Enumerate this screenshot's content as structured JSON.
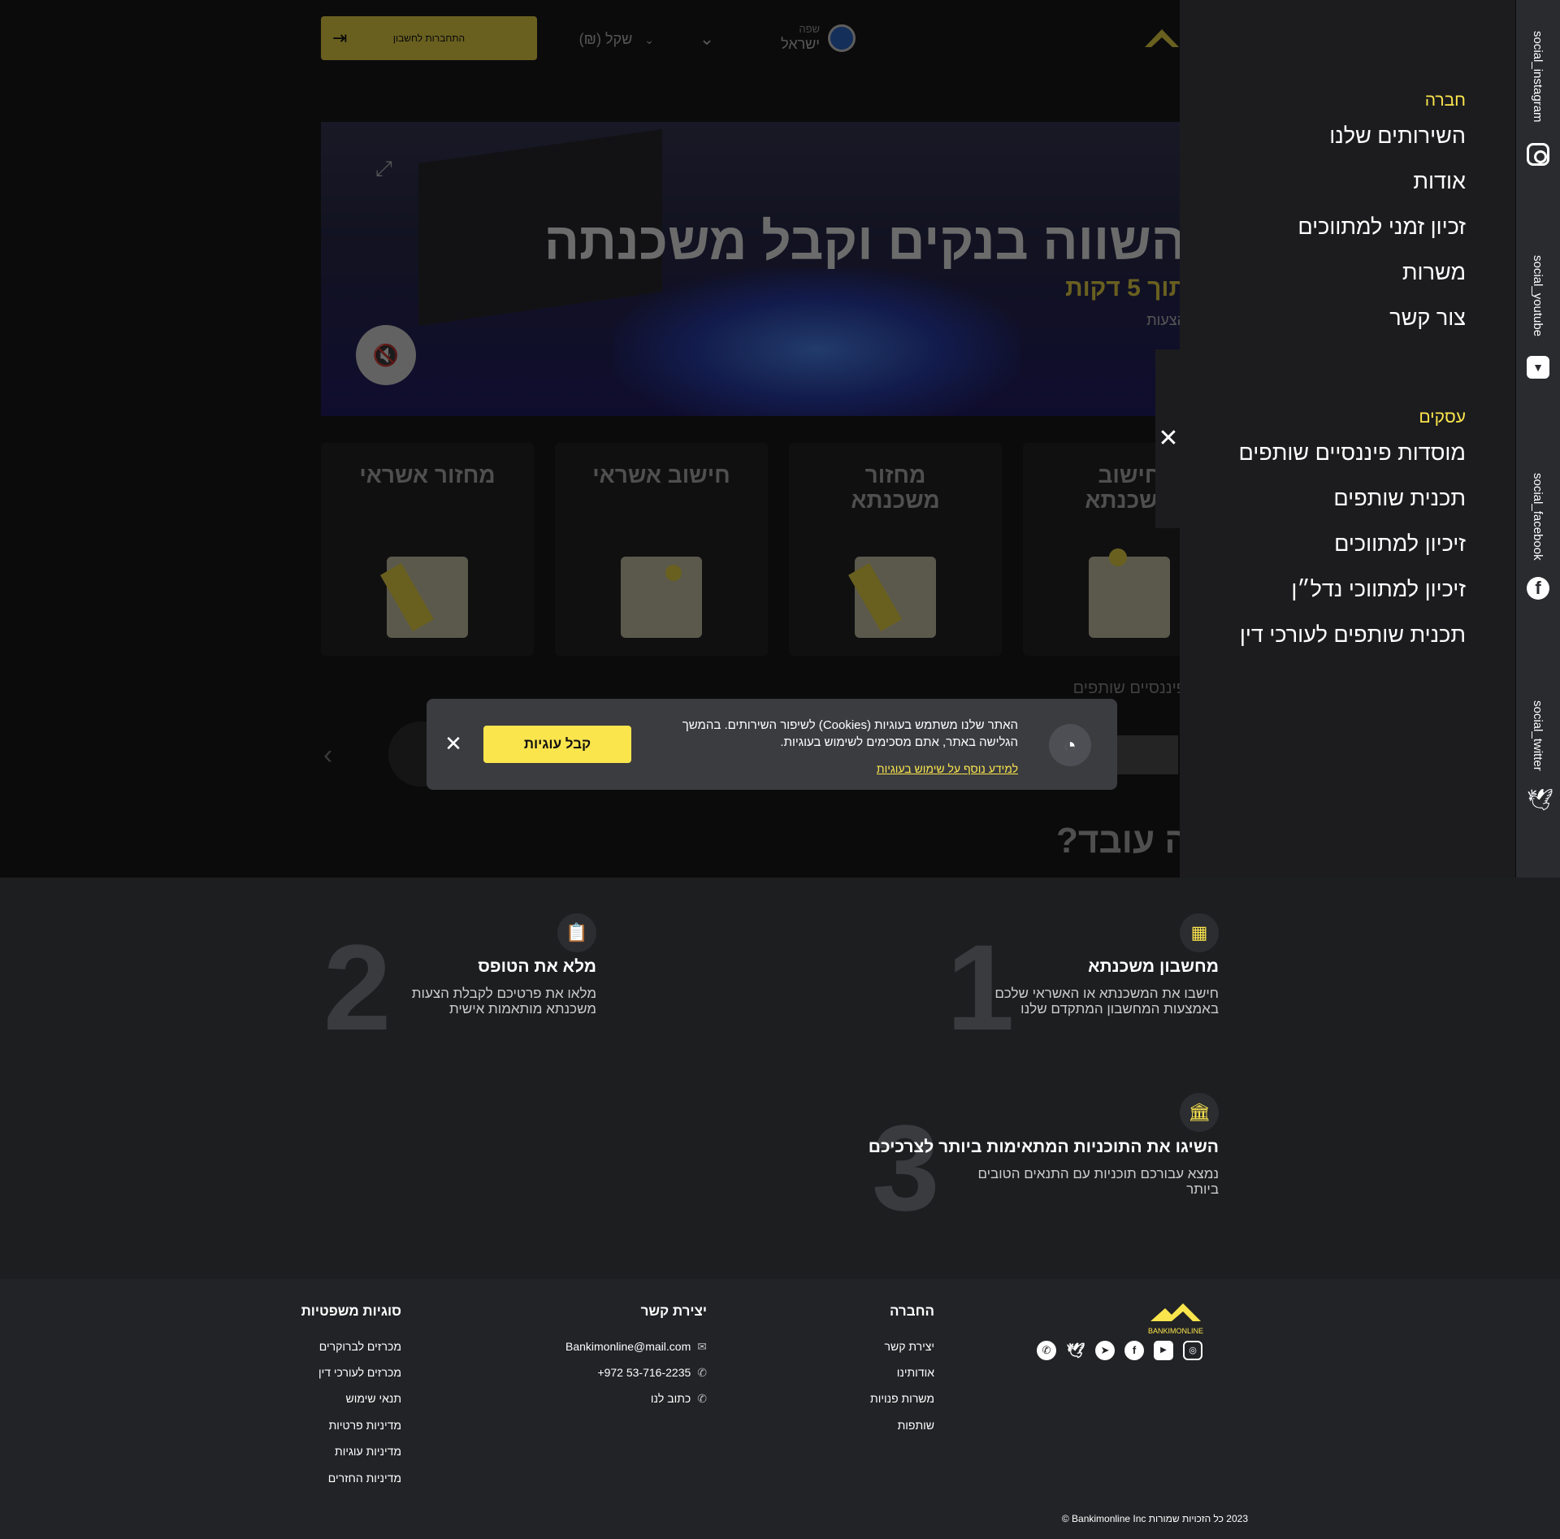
{
  "header": {
    "language_caption": "שפה",
    "language_value": "ישראל",
    "currency": "שקל (₪)",
    "login_label": "התחברות לחשבון"
  },
  "hero": {
    "title": "השווה בנקים וקבל משכנתה",
    "subtitle": "תוך 5 דקות",
    "subtitle2": "הצעות"
  },
  "cards": [
    {
      "title": "מחזור אשראי"
    },
    {
      "title": "חישוב אשראי"
    },
    {
      "title": "מחזור משכנתא"
    },
    {
      "title": "חישוב משכנתא"
    }
  ],
  "partners_label": "פיננסיים שותפים",
  "how_title": "?זה עובד",
  "cookie": {
    "text": "האתר שלנו משתמש בעוגיות (Cookies) לשיפור השירותים. בהמשך הגלישה באתר, אתם מסכימים לשימוש בעוגיות.",
    "more": "למידע נוסף על שימוש בעוגיות",
    "accept": "קבל עוגיות"
  },
  "side_menu": {
    "company_heading": "חברה",
    "company_items": [
      "השירותים שלנו",
      "אודות",
      "זכיון זמני למתווכים",
      "משרות",
      "צור קשר"
    ],
    "business_heading": "עסקים",
    "business_items": [
      "מוסדות פיננסיים שותפים",
      "תכנית שותפים",
      "זיכיון למתווכים",
      "זיכיון למתווכי נדל״ן",
      "תכנית שותפים לעורכי דין"
    ]
  },
  "social_bar": [
    "social_instagram",
    "social_youtube",
    "social_facebook",
    "social_twitter"
  ],
  "steps": [
    {
      "number": "1",
      "title": "מחשבון משכנתא",
      "description": "חישבו את המשכנתא או האשראי שלכם באמצעות המחשבון המתקדם שלנו",
      "icon": "calculator-icon"
    },
    {
      "number": "2",
      "title": "מלא את הטופס",
      "description": "מלאו את פרטיכם לקבלת הצעות משכנתא מותאמות אישית",
      "icon": "clipboard-icon"
    },
    {
      "number": "3",
      "title": "השיגו את התוכניות המתאימות ביותר לצרכיכם",
      "description": "נמצא עבורכם תוכניות עם התנאים הטובים ביותר",
      "icon": "bank-icon"
    }
  ],
  "footer": {
    "logo_text": "BANKIMONLINE",
    "company": {
      "heading": "החברה",
      "links": [
        "יצירת קשר",
        "אודותינו",
        "משרות פנויות",
        "שותפות"
      ]
    },
    "contact": {
      "heading": "יצירת קשר",
      "email": "Bankimonline@mail.com",
      "phone": "+972 53-716-2235",
      "write": "כתוב לנו"
    },
    "legal": {
      "heading": "סוגיות משפטיות",
      "links": [
        "מכרזים לברוקרים",
        "מכרזים לעורכי דין",
        "תנאי שימוש",
        "מדיניות פרטיות",
        "מדיניות עוגיות",
        "מדיניות החזרים"
      ]
    },
    "copyright": "2023 כל הזכויות שמורות Bankimonline Inc ©"
  },
  "colors": {
    "accent": "#fbe54d",
    "background": "#1d1e20",
    "footer": "#222326",
    "menu": "#1c1c1e"
  }
}
